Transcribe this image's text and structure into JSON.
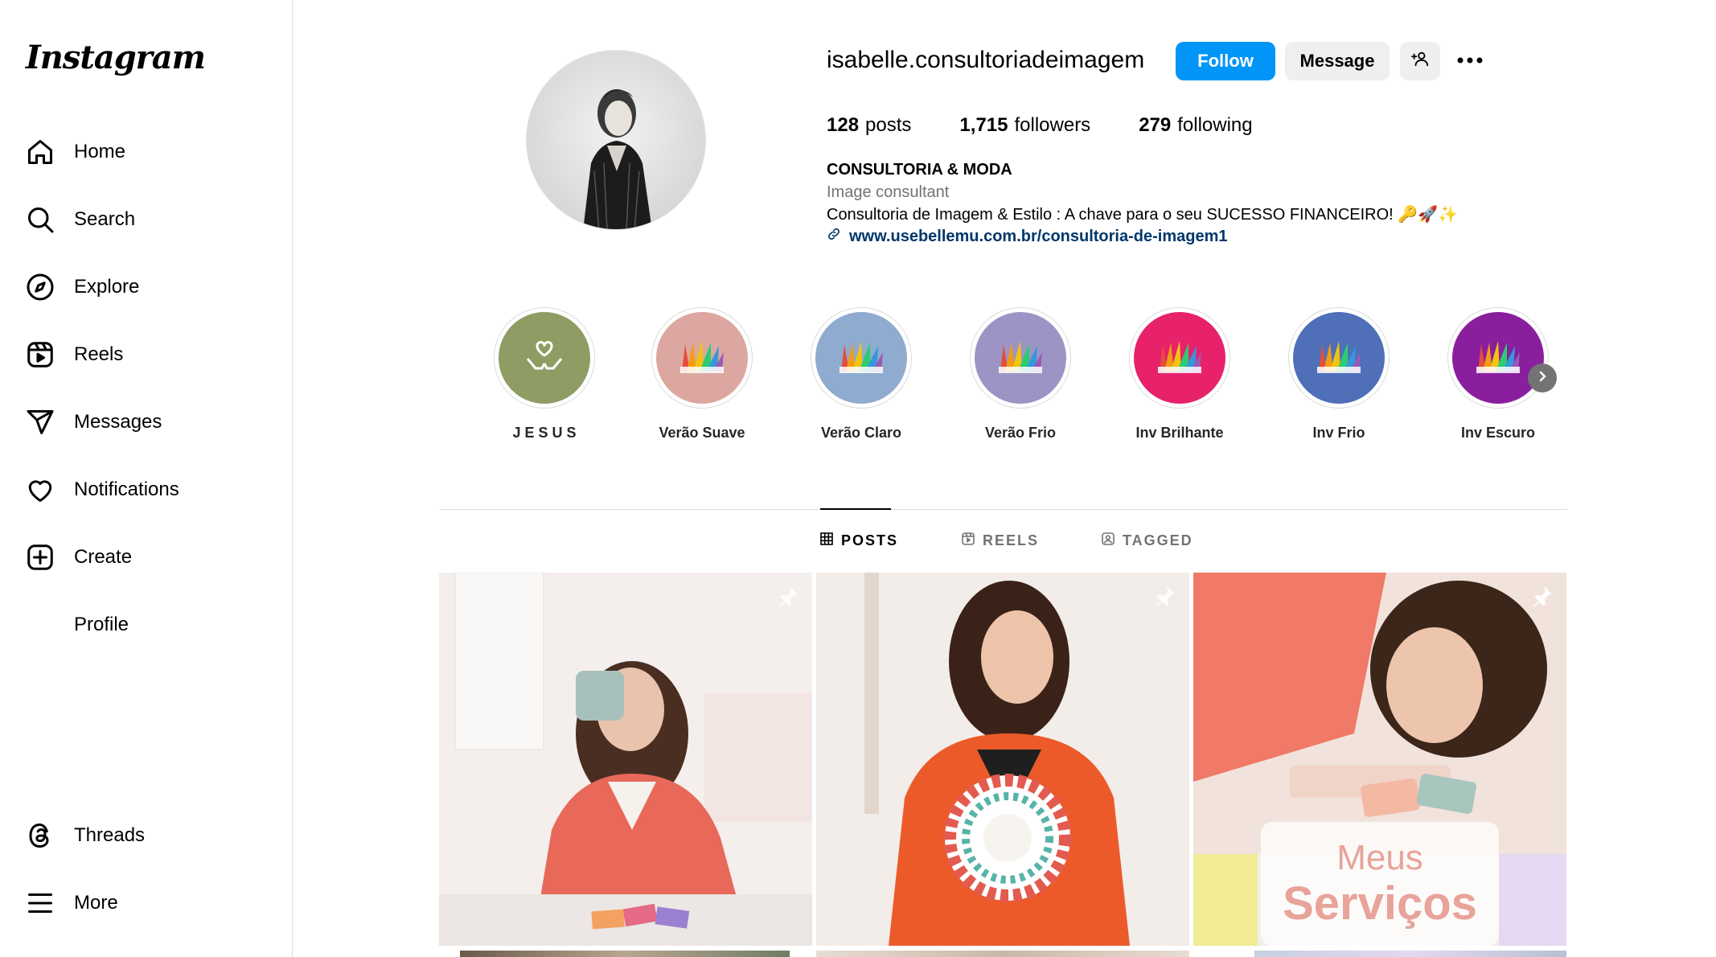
{
  "sidebar": {
    "logo": "Instagram",
    "items": [
      {
        "label": "Home",
        "icon": "home-icon"
      },
      {
        "label": "Search",
        "icon": "search-icon"
      },
      {
        "label": "Explore",
        "icon": "compass-icon"
      },
      {
        "label": "Reels",
        "icon": "reels-icon"
      },
      {
        "label": "Messages",
        "icon": "paper-plane-icon"
      },
      {
        "label": "Notifications",
        "icon": "heart-icon"
      },
      {
        "label": "Create",
        "icon": "plus-square-icon"
      },
      {
        "label": "Profile",
        "icon": "profile-avatar"
      }
    ],
    "bottom": [
      {
        "label": "Threads",
        "icon": "threads-icon"
      },
      {
        "label": "More",
        "icon": "menu-icon"
      }
    ]
  },
  "profile": {
    "username": "isabelle.consultoriadeimagem",
    "follow_label": "Follow",
    "message_label": "Message",
    "stats": {
      "posts_count": "128",
      "posts_label": "posts",
      "followers_count": "1,715",
      "followers_label": "followers",
      "following_count": "279",
      "following_label": "following"
    },
    "bio": {
      "name": "CONSULTORIA & MODA",
      "category": "Image consultant",
      "text": "Consultoria de Imagem & Estilo : A chave para o seu SUCESSO FINANCEIRO! 🔑🚀✨",
      "link": "www.usebellemu.com.br/consultoria-de-imagem1"
    }
  },
  "highlights": [
    {
      "label": "J E S U S",
      "color": "#8f9c63"
    },
    {
      "label": "Verão Suave",
      "color": "#dca7a0"
    },
    {
      "label": "Verão Claro",
      "color": "#8fabcf"
    },
    {
      "label": "Verão Frio",
      "color": "#9d94c6"
    },
    {
      "label": "Inv Brilhante",
      "color": "#e8216b"
    },
    {
      "label": "Inv Frio",
      "color": "#4f6fb8"
    },
    {
      "label": "Inv Escuro",
      "color": "#8a1f9e"
    }
  ],
  "tabs": [
    {
      "label": "POSTS",
      "active": true
    },
    {
      "label": "REELS",
      "active": false
    },
    {
      "label": "TAGGED",
      "active": false
    }
  ],
  "posts": [
    {
      "overlay_line1": "",
      "overlay_line2": ""
    },
    {
      "overlay_line1": "",
      "overlay_line2": ""
    },
    {
      "overlay_line1": "Meus",
      "overlay_line2": "Serviços"
    }
  ],
  "colors": {
    "accent": "#0095f6",
    "link": "#00376b",
    "secondary_text": "#737373",
    "border": "#dbdbdb"
  }
}
